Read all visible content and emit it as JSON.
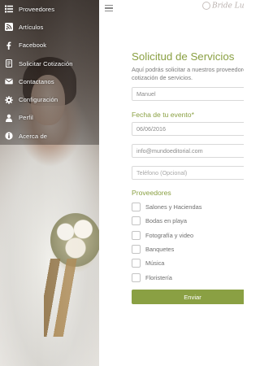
{
  "menu": {
    "items": [
      {
        "label": "Proveedores",
        "icon": "list-icon"
      },
      {
        "label": "Artículos",
        "icon": "rss-icon"
      },
      {
        "label": "Facebook",
        "icon": "facebook-icon"
      },
      {
        "label": "Solicitar Cotización",
        "icon": "document-icon"
      },
      {
        "label": "Contactanos",
        "icon": "envelope-icon"
      },
      {
        "label": "Configuración",
        "icon": "gear-icon"
      },
      {
        "label": "Perfil",
        "icon": "person-icon"
      },
      {
        "label": "Acerca de",
        "icon": "info-icon"
      }
    ]
  },
  "header": {
    "logo_text": "Bride Lux"
  },
  "form": {
    "title": "Solicitud de Servicios",
    "description": "Aquí podrás solicitar a nuestros proveedores cotización de servicios.",
    "name_value": "Manuel",
    "date_label": "Fecha de tu evento*",
    "date_value": "06/06/2016",
    "email_value": "info@mundoeditorial.com",
    "phone_placeholder": "Teléfono (Opcional)",
    "providers_label": "Proveedores",
    "providers": [
      "Salones y Haciendas",
      "Bodas en playa",
      "Fotografía y video",
      "Banquetes",
      "Música",
      "Floristería"
    ],
    "submit_label": "Enviar"
  },
  "colors": {
    "accent": "#8aa043",
    "text_muted": "#7a7a7a",
    "border": "#d9d9d9"
  }
}
